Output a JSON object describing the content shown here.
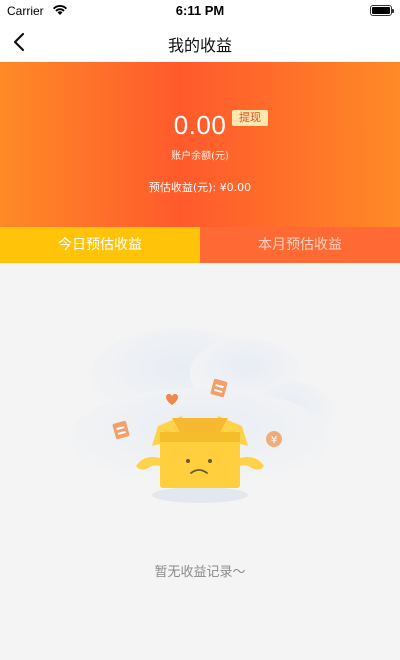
{
  "status_bar": {
    "carrier": "Carrier",
    "time": "6:11 PM"
  },
  "nav": {
    "title": "我的收益"
  },
  "account": {
    "balance": "0.00",
    "withdraw_label": "提现",
    "balance_label": "账户余额(元)",
    "estimate_text": "预估收益(元): ¥0.00"
  },
  "tabs": [
    {
      "label": "今日预估收益",
      "active": true
    },
    {
      "label": "本月预估收益",
      "active": false
    }
  ],
  "empty_state": {
    "message": "暂无收益记录～"
  },
  "colors": {
    "header_gradient_start": "#ff8a26",
    "header_gradient_mid": "#ff5a2c",
    "active_tab": "#ffc40a",
    "inactive_tab": "#ff6a34",
    "withdraw_badge_bg": "#ffe7b0"
  },
  "icons": {
    "back": "chevron-left-icon",
    "empty": "empty-box-icon"
  }
}
